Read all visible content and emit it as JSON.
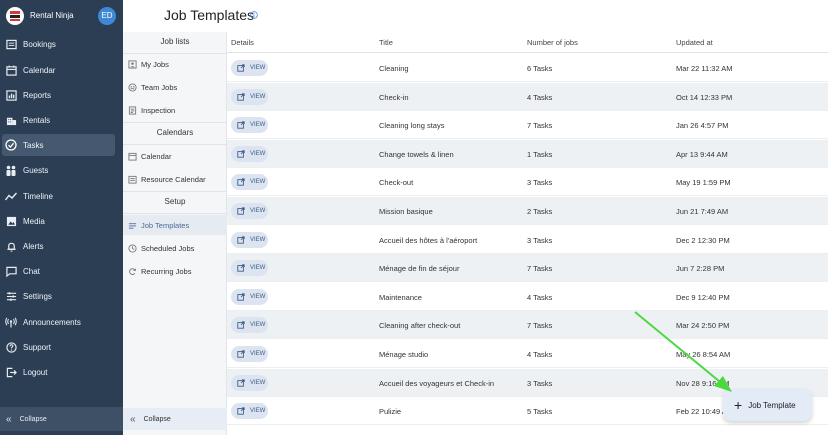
{
  "app": {
    "name": "Rental Ninja",
    "avatar_initials": "ED"
  },
  "colors": {
    "sidebar": "#2b3e54",
    "accent": "#3e88d6",
    "arrow": "#4cd940"
  },
  "sidebar": {
    "items": [
      {
        "label": "Bookings",
        "icon": "bookings-icon"
      },
      {
        "label": "Calendar",
        "icon": "calendar-icon"
      },
      {
        "label": "Reports",
        "icon": "reports-icon"
      },
      {
        "label": "Rentals",
        "icon": "rentals-icon"
      },
      {
        "label": "Tasks",
        "icon": "tasks-icon",
        "active": true
      },
      {
        "label": "Guests",
        "icon": "guests-icon"
      },
      {
        "label": "Timeline",
        "icon": "timeline-icon"
      },
      {
        "label": "Media",
        "icon": "media-icon"
      },
      {
        "label": "Alerts",
        "icon": "alerts-icon"
      },
      {
        "label": "Chat",
        "icon": "chat-icon"
      },
      {
        "label": "Settings",
        "icon": "settings-icon"
      },
      {
        "label": "Announcements",
        "icon": "announcements-icon"
      },
      {
        "label": "Support",
        "icon": "support-icon"
      },
      {
        "label": "Logout",
        "icon": "logout-icon"
      }
    ],
    "collapse_label": "Collapse"
  },
  "subnav": {
    "job_lists_heading": "Job lists",
    "job_lists": [
      {
        "label": "My Jobs",
        "icon": "person-icon"
      },
      {
        "label": "Team Jobs",
        "icon": "team-icon"
      },
      {
        "label": "Inspection",
        "icon": "inspection-icon"
      }
    ],
    "calendars_heading": "Calendars",
    "calendars": [
      {
        "label": "Calendar",
        "icon": "calendar-icon"
      },
      {
        "label": "Resource Calendar",
        "icon": "resource-calendar-icon"
      }
    ],
    "setup_heading": "Setup",
    "setup": [
      {
        "label": "Job Templates",
        "icon": "templates-icon",
        "active": true
      },
      {
        "label": "Scheduled Jobs",
        "icon": "clock-icon"
      },
      {
        "label": "Recurring Jobs",
        "icon": "recurring-icon"
      }
    ],
    "collapse_label": "Collapse"
  },
  "page": {
    "title": "Job Templates"
  },
  "table": {
    "columns": [
      "Details",
      "Title",
      "Number of jobs",
      "Updated at"
    ],
    "view_label": "VIEW",
    "rows": [
      {
        "title": "Cleaning",
        "jobs": "6 Tasks",
        "updated": "Mar 22 11:32 AM"
      },
      {
        "title": "Check-in",
        "jobs": "4 Tasks",
        "updated": "Oct 14 12:33 PM"
      },
      {
        "title": "Cleaning long stays",
        "jobs": "7 Tasks",
        "updated": "Jan 26 4:57 PM"
      },
      {
        "title": "Change towels & linen",
        "jobs": "1 Tasks",
        "updated": "Apr 13 9:44 AM"
      },
      {
        "title": "Check-out",
        "jobs": "3 Tasks",
        "updated": "May 19 1:59 PM"
      },
      {
        "title": "Mission basique",
        "jobs": "2 Tasks",
        "updated": "Jun 21 7:49 AM"
      },
      {
        "title": "Accueil des hôtes à l'aéroport",
        "jobs": "3 Tasks",
        "updated": "Dec 2 12:30 PM"
      },
      {
        "title": "Ménage de fin de séjour",
        "jobs": "7 Tasks",
        "updated": "Jun 7 2:28 PM"
      },
      {
        "title": "Maintenance",
        "jobs": "4 Tasks",
        "updated": "Dec 9 12:40 PM"
      },
      {
        "title": "Cleaning after check-out",
        "jobs": "7 Tasks",
        "updated": "Mar 24 2:50 PM"
      },
      {
        "title": "Ménage studio",
        "jobs": "4 Tasks",
        "updated": "May 26 8:54 AM"
      },
      {
        "title": "Accueil des voyageurs et Check-in",
        "jobs": "3 Tasks",
        "updated": "Nov 28 9:16 AM"
      },
      {
        "title": "Pulizie",
        "jobs": "5 Tasks",
        "updated": "Feb 22 10:49 AM"
      }
    ]
  },
  "fab": {
    "label": "Job Template"
  }
}
